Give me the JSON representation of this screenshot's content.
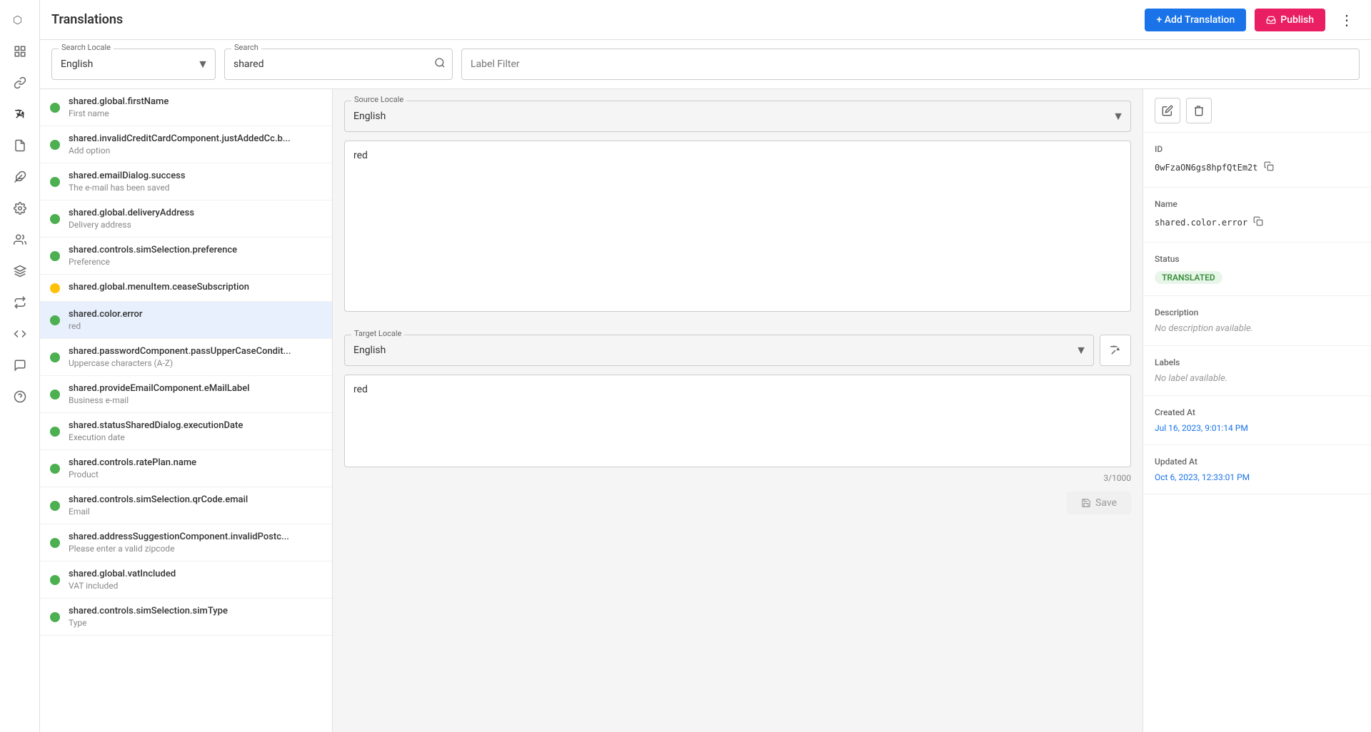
{
  "header": {
    "title": "Translations",
    "add_button": "+ Add Translation",
    "publish_button": "Publish"
  },
  "filters": {
    "search_locale_label": "Search Locale",
    "search_locale_value": "English",
    "search_label": "Search",
    "search_value": "shared",
    "label_filter_placeholder": "Label Filter"
  },
  "list": {
    "items": [
      {
        "key": "shared.global.firstName",
        "value": "First name",
        "status": "green"
      },
      {
        "key": "shared.invalidCreditCardComponent.justAddedCc.b...",
        "value": "Add option",
        "status": "green"
      },
      {
        "key": "shared.emailDialog.success",
        "value": "The e-mail has been saved",
        "status": "green"
      },
      {
        "key": "shared.global.deliveryAddress",
        "value": "Delivery address",
        "status": "green"
      },
      {
        "key": "shared.controls.simSelection.preference",
        "value": "Preference",
        "status": "green"
      },
      {
        "key": "shared.global.menuItem.ceaseSubscription",
        "value": "",
        "status": "yellow"
      },
      {
        "key": "shared.color.error",
        "value": "red",
        "status": "green",
        "active": true
      },
      {
        "key": "shared.passwordComponent.passUpperCaseCondit...",
        "value": "Uppercase characters (A-Z)",
        "status": "green"
      },
      {
        "key": "shared.provideEmailComponent.eMailLabel",
        "value": "Business e-mail",
        "status": "green"
      },
      {
        "key": "shared.statusSharedDialog.executionDate",
        "value": "Execution date",
        "status": "green"
      },
      {
        "key": "shared.controls.ratePlan.name",
        "value": "Product",
        "status": "green"
      },
      {
        "key": "shared.controls.simSelection.qrCode.email",
        "value": "Email",
        "status": "green"
      },
      {
        "key": "shared.addressSuggestionComponent.invalidPostc...",
        "value": "Please enter a valid zipcode",
        "status": "green"
      },
      {
        "key": "shared.global.vatIncluded",
        "value": "VAT included",
        "status": "green"
      },
      {
        "key": "shared.controls.simSelection.simType",
        "value": "Type",
        "status": "green"
      }
    ]
  },
  "source_locale": {
    "label": "Source Locale",
    "value": "English",
    "text": "red"
  },
  "target_locale": {
    "label": "Target Locale",
    "value": "English",
    "text": "red",
    "char_count": "3/1000"
  },
  "save_button": "Save",
  "right_panel": {
    "id_label": "ID",
    "id_value": "0wFzaON6gs8hpfQtEm2t",
    "name_label": "Name",
    "name_value": "shared.color.error",
    "status_label": "Status",
    "status_value": "TRANSLATED",
    "description_label": "Description",
    "description_value": "No description available.",
    "labels_label": "Labels",
    "labels_value": "No label available.",
    "created_at_label": "Created At",
    "created_at_value": "Jul 16, 2023, 9:01:14 PM",
    "updated_at_label": "Updated At",
    "updated_at_value": "Oct 6, 2023, 12:33:01 PM"
  }
}
